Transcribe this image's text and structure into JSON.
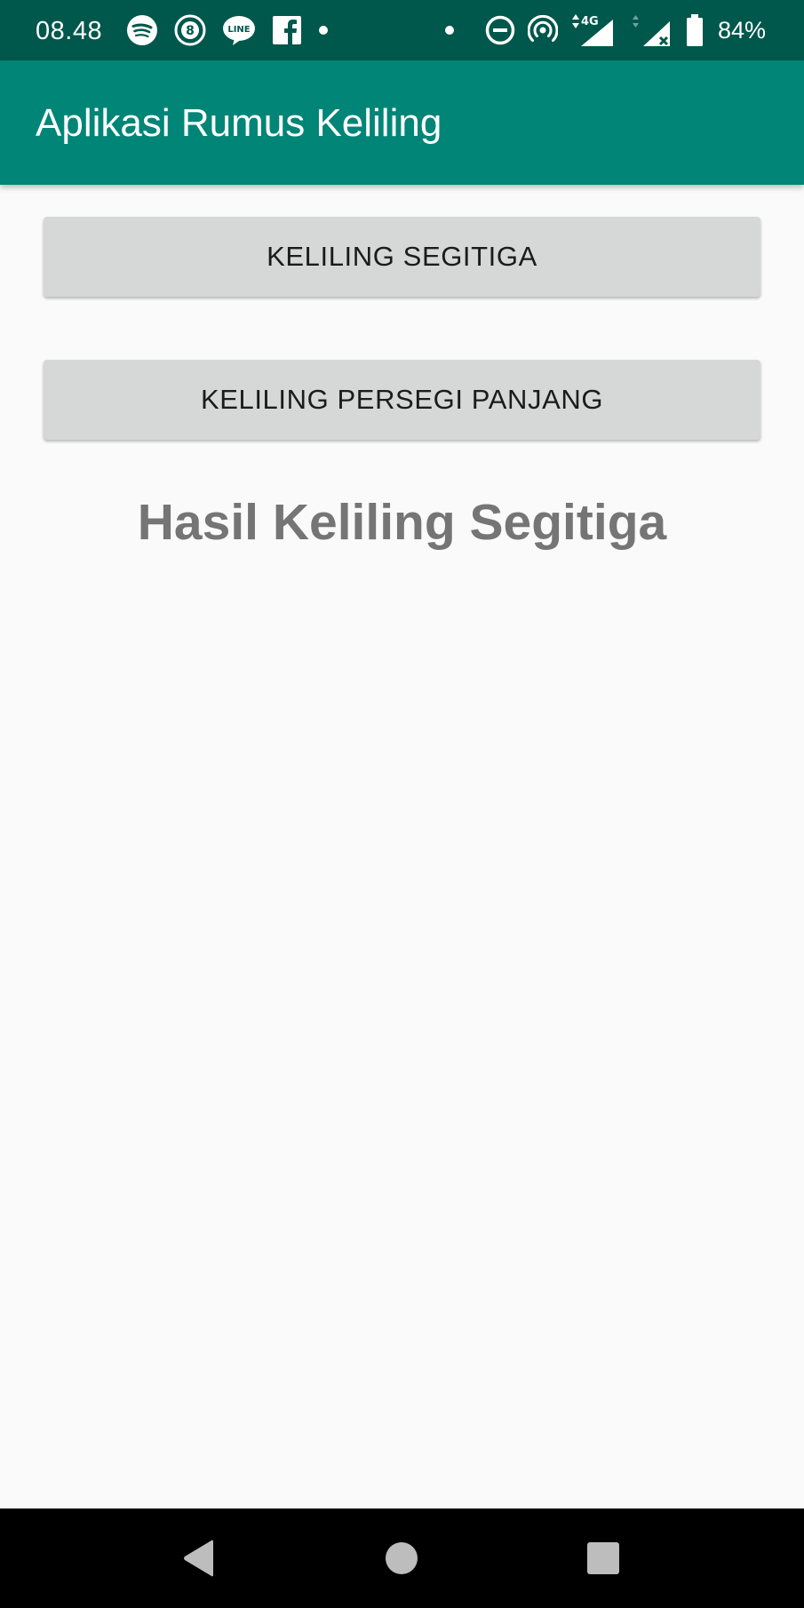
{
  "status_bar": {
    "time": "08.48",
    "battery_percent": "84%",
    "network_type": "4G",
    "notification_icons": [
      "spotify-icon",
      "eight-ball-icon",
      "line-icon",
      "facebook-icon",
      "dot-icon"
    ],
    "system_icons": [
      "dot-icon",
      "do-not-disturb-icon",
      "hotspot-icon",
      "signal-4g-icon",
      "signal-no-sim-icon",
      "battery-icon"
    ]
  },
  "app_bar": {
    "title": "Aplikasi Rumus Keliling",
    "color": "#008577",
    "status_color": "#00574b"
  },
  "buttons": {
    "triangle_label": "KELILING SEGITIGA",
    "rectangle_label": "KELILING PERSEGI PANJANG"
  },
  "result": {
    "text": "Hasil Keliling Segitiga"
  },
  "nav_bar": {
    "icons": [
      "back-icon",
      "home-icon",
      "recents-icon"
    ]
  }
}
